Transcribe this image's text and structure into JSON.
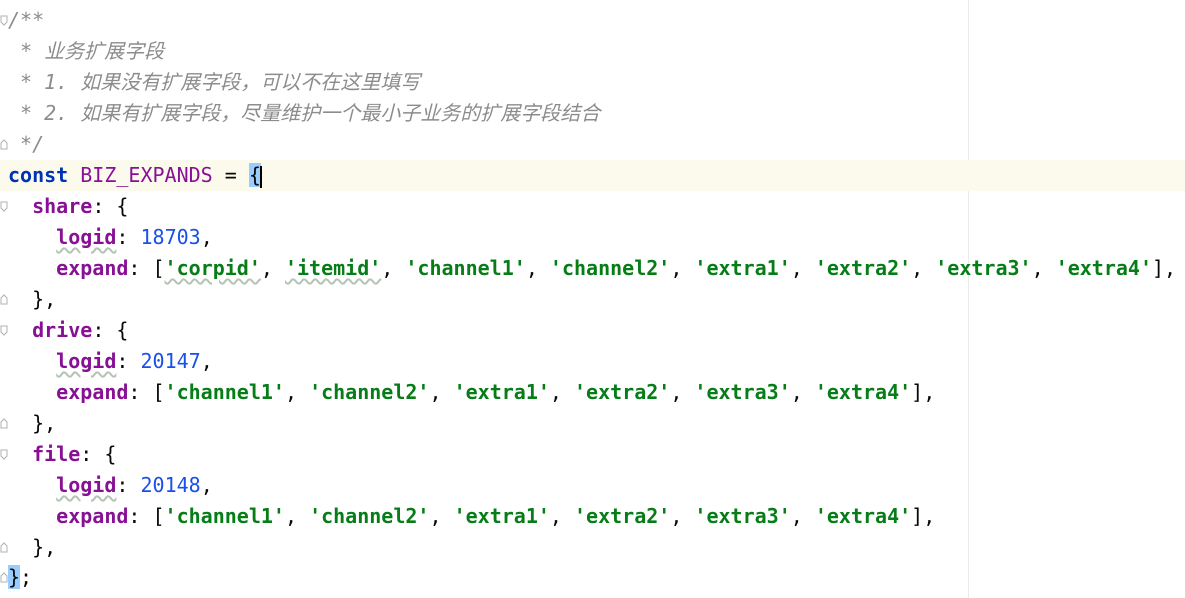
{
  "comment": {
    "open": "/**",
    "line1": " * 业务扩展字段",
    "line2": " * 1. 如果没有扩展字段，可以不在这里填写",
    "line3": " * 2. 如果有扩展字段，尽量维护一个最小子业务的扩展字段结合",
    "close": " */"
  },
  "declaration": {
    "keyword": "const",
    "name": "BIZ_EXPANDS",
    "assign": " = ",
    "open_brace": "{"
  },
  "entries": [
    {
      "key": "share",
      "logid_label": "logid",
      "logid": "18703",
      "expand_label": "expand",
      "expand": [
        "'corpid'",
        "'itemid'",
        "'channel1'",
        "'channel2'",
        "'extra1'",
        "'extra2'",
        "'extra3'",
        "'extra4'"
      ]
    },
    {
      "key": "drive",
      "logid_label": "logid",
      "logid": "20147",
      "expand_label": "expand",
      "expand": [
        "'channel1'",
        "'channel2'",
        "'extra1'",
        "'extra2'",
        "'extra3'",
        "'extra4'"
      ]
    },
    {
      "key": "file",
      "logid_label": "logid",
      "logid": "20148",
      "expand_label": "expand",
      "expand": [
        "'channel1'",
        "'channel2'",
        "'extra1'",
        "'extra2'",
        "'extra3'",
        "'extra4'"
      ]
    }
  ],
  "closing": {
    "brace": "}",
    "semicolon": ";"
  },
  "colors": {
    "keyword": "#0033b3",
    "property": "#871094",
    "number": "#1750eb",
    "string": "#067d17",
    "comment": "#8c8c8c",
    "current_line": "#fcfaed",
    "brace_match": "#99ccff"
  }
}
